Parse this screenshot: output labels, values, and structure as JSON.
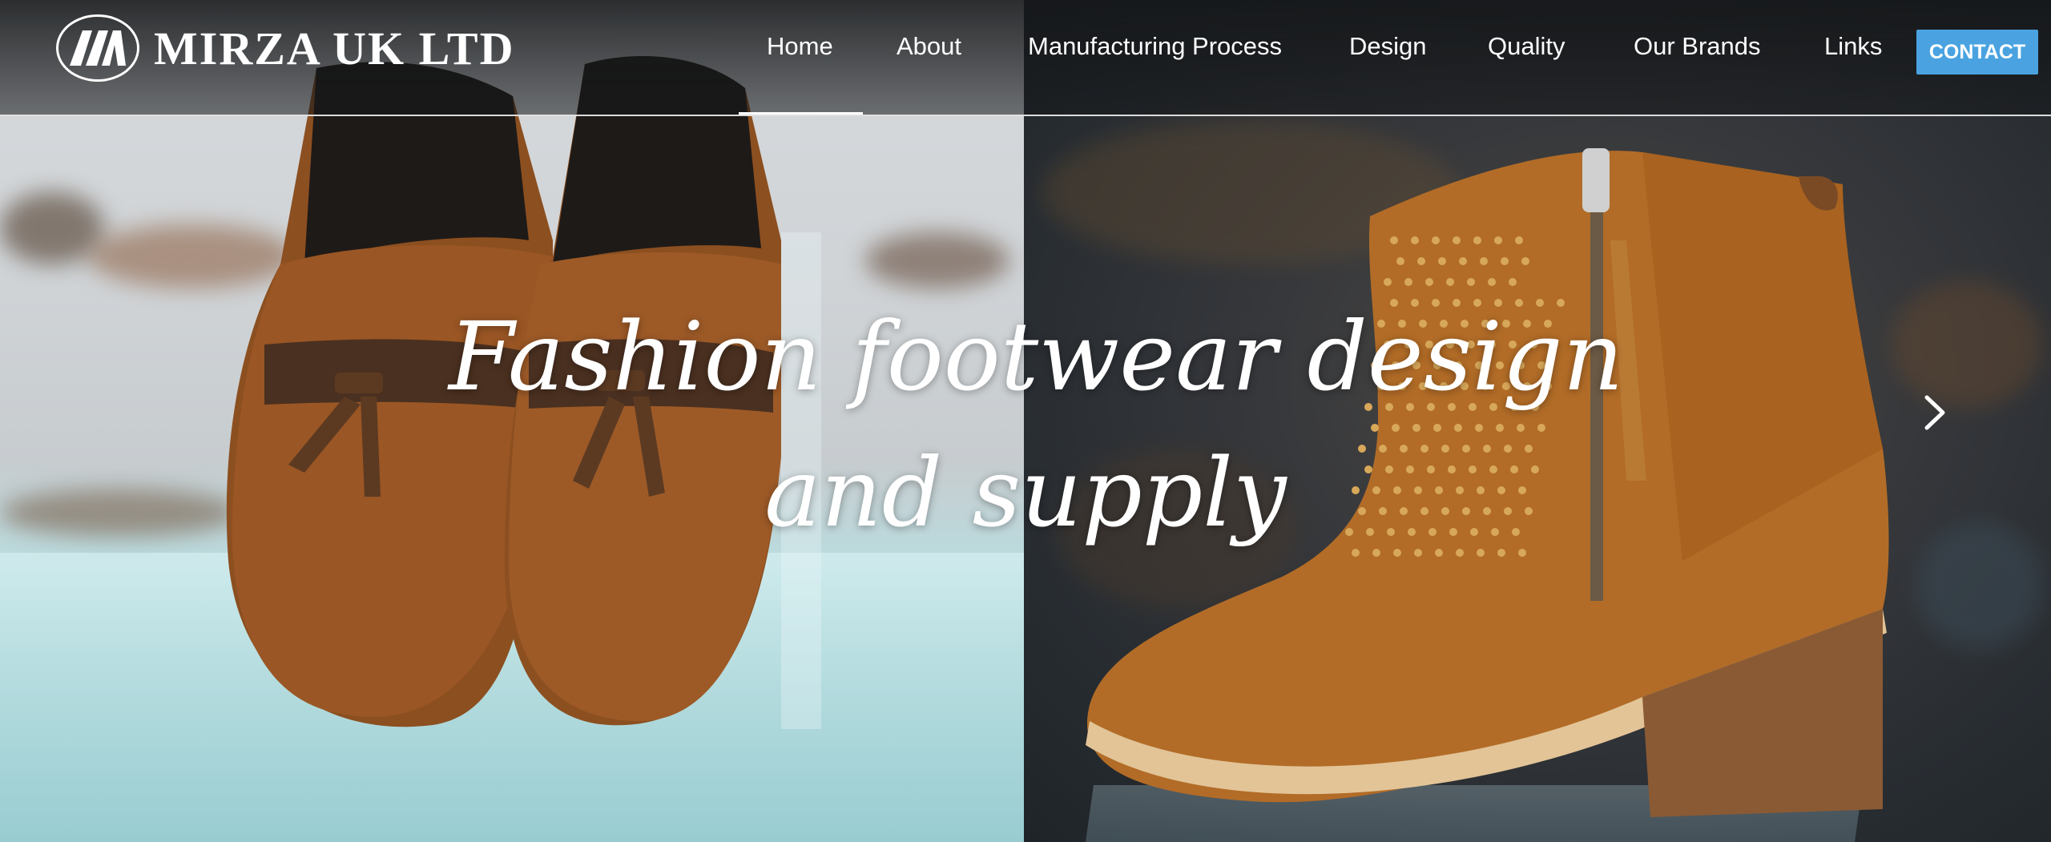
{
  "brand": {
    "name": "MIRZA UK LTD",
    "logo_icon": "mirza-logo-mark"
  },
  "nav": {
    "items": [
      {
        "label": "Home",
        "active": true
      },
      {
        "label": "About"
      },
      {
        "label": "Manufacturing Process"
      },
      {
        "label": "Design"
      },
      {
        "label": "Quality"
      },
      {
        "label": "Our Brands"
      },
      {
        "label": "Links"
      }
    ],
    "contact_label": "CONTACT"
  },
  "hero": {
    "headline_line1": "Fashion footwear design",
    "headline_line2": "and supply",
    "next_icon": "chevron-right-icon"
  },
  "colors": {
    "accent": "#4aa3e0",
    "header_bg": "#141618",
    "text": "#ffffff"
  }
}
